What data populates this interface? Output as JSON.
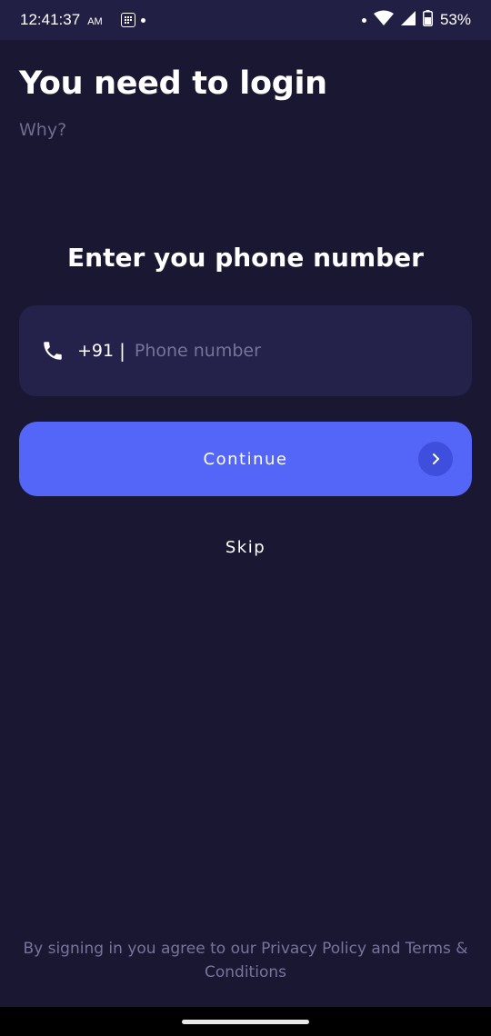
{
  "status_bar": {
    "time": "12:41:37",
    "ampm": "AM",
    "battery": "53%",
    "icons": [
      "app-notification-icon",
      "dot-icon",
      "wifi-icon",
      "signal-icon",
      "battery-icon"
    ]
  },
  "header": {
    "title": "You need to login",
    "why_link": "Why?"
  },
  "phone": {
    "heading": "Enter you phone number",
    "country_code": "+91",
    "separator": "|",
    "placeholder": "Phone number",
    "value": "",
    "icon": "phone-icon"
  },
  "actions": {
    "continue_label": "Continue",
    "continue_icon": "chevron-right-icon",
    "skip_label": "Skip"
  },
  "legal": {
    "text": "By signing in you agree to our Privacy Policy and Terms & Conditions"
  },
  "colors": {
    "background": "#1a1733",
    "field": "#24214a",
    "accent": "#5466f7",
    "muted_text": "#77749a"
  }
}
